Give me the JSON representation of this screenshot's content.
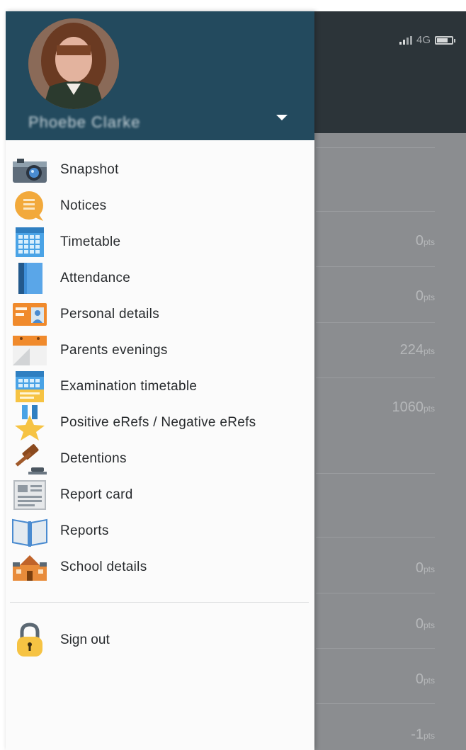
{
  "status_bar": {
    "network": "4G"
  },
  "drawer": {
    "user_name": "Phoebe Clarke",
    "menu_items": [
      {
        "label": "Snapshot",
        "icon": "camera-icon"
      },
      {
        "label": "Notices",
        "icon": "notice-bubble-icon"
      },
      {
        "label": "Timetable",
        "icon": "calendar-grid-icon"
      },
      {
        "label": "Attendance",
        "icon": "register-book-icon"
      },
      {
        "label": "Personal details",
        "icon": "id-card-icon"
      },
      {
        "label": "Parents evenings",
        "icon": "desk-calendar-icon"
      },
      {
        "label": "Examination timetable",
        "icon": "exam-calendar-icon"
      },
      {
        "label": "Positive eRefs / Negative eRefs",
        "icon": "star-medal-icon"
      },
      {
        "label": "Detentions",
        "icon": "gavel-icon"
      },
      {
        "label": "Report card",
        "icon": "report-card-icon"
      },
      {
        "label": "Reports",
        "icon": "open-book-icon"
      },
      {
        "label": "School details",
        "icon": "school-building-icon"
      }
    ],
    "sign_out_label": "Sign out"
  },
  "background_list": {
    "rows": [
      {
        "value": "",
        "unit": ""
      },
      {
        "value": "0",
        "unit": "pts"
      },
      {
        "value": "0",
        "unit": "pts"
      },
      {
        "value": "224",
        "unit": "pts"
      },
      {
        "value": "1060",
        "unit": "pts"
      },
      {
        "value": "",
        "unit": ""
      },
      {
        "value": "0",
        "unit": "pts"
      },
      {
        "value": "0",
        "unit": "pts"
      },
      {
        "value": "0",
        "unit": "pts"
      },
      {
        "value": "-1",
        "unit": "pts"
      }
    ]
  },
  "colors": {
    "drawer_header": "#234a5e",
    "overlay": "#8b8d90",
    "app_header": "#2c3439"
  }
}
